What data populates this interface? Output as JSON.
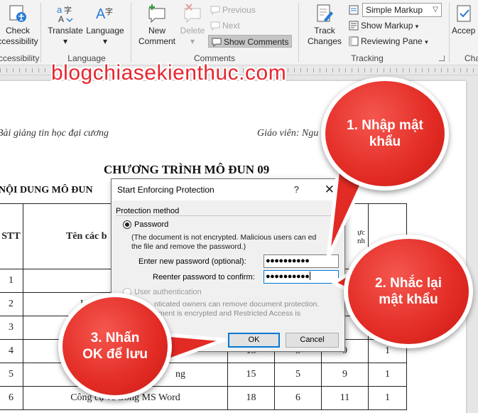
{
  "ribbon": {
    "accessibility": {
      "label_line1": "Check",
      "label_line2": "ccessibility",
      "group": "ccessibility"
    },
    "language_group": {
      "translate_label": "Translate",
      "translate_dropdown": "▾",
      "language_label": "Language",
      "language_dropdown": "▾",
      "group": "Language"
    },
    "comments_group": {
      "new_comment_line1": "New",
      "new_comment_line2": "Comment",
      "delete_label": "Delete",
      "previous_label": "Previous",
      "next_label": "Next",
      "show_comments_label": "Show Comments",
      "group": "Comments"
    },
    "tracking_group": {
      "track_changes_line1": "Track",
      "track_changes_line2": "Changes",
      "markup_dropdown": "Simple Markup",
      "show_markup_label": "Show Markup",
      "reviewing_pane_label": "Reviewing Pane",
      "group": "Tracking"
    },
    "accept_group": {
      "accept_label": "Accep",
      "group": "Cha"
    }
  },
  "watermark": "blogchiasekienthuc.com",
  "document": {
    "header_left": "Bài giảng tin học đại cương",
    "header_right": "Giáo viên: Ngu",
    "heading": "CHƯƠNG TRÌNH MÔ ĐUN 09",
    "subheading": "NỘI DUNG MÔ ĐUN",
    "table": {
      "header": {
        "stt": "STT",
        "name": "Tên các b",
        "col5": "ực",
        "col5b": "nh"
      },
      "rows": [
        {
          "stt": "1",
          "name": "B",
          "c3": "",
          "c4": "",
          "c5": "",
          "c6": ""
        },
        {
          "stt": "2",
          "name": "Làn",
          "c3": "",
          "c4": "",
          "c5": "6",
          "c6": ""
        },
        {
          "stt": "3",
          "name": "",
          "c3": "",
          "c4": "",
          "c5": "7",
          "c6": ""
        },
        {
          "stt": "4",
          "name": "Ch                   rs Word",
          "c3": "15",
          "c4": "5",
          "c5": "9",
          "c6": "1"
        },
        {
          "stt": "5",
          "name": "ng",
          "c3": "15",
          "c4": "5",
          "c5": "9",
          "c6": "1"
        },
        {
          "stt": "6",
          "name": "Công cụ vẽ trong MS Word",
          "c3": "18",
          "c4": "6",
          "c5": "11",
          "c6": "1"
        }
      ]
    }
  },
  "dialog": {
    "title": "Start Enforcing Protection",
    "help": "?",
    "close": "✕",
    "section_label": "Protection method",
    "password_option": "Password",
    "password_note_line1": "(The document is not encrypted. Malicious users can ed",
    "password_note_line2": "the file and remove the password.)",
    "new_password_label": "Enter new password (optional):",
    "new_password_value": "●●●●●●●●●●",
    "reenter_password_label": "Reenter password to confirm:",
    "reenter_password_value": "●●●●●●●●●●",
    "user_auth_option": "User authentication",
    "user_auth_note_line1": "nticated owners can remove document protection.",
    "user_auth_note_line2": "ument is encrypted and Restricted Access is",
    "ok_label": "OK",
    "cancel_label": "Cancel"
  },
  "callouts": [
    {
      "line1": "1. Nhập mật",
      "line2": "khẩu"
    },
    {
      "line1": "2. Nhắc lại",
      "line2": "mật khẩu"
    },
    {
      "line1": "3. Nhấn",
      "line2": "OK để lưu"
    }
  ],
  "colors": {
    "callout_red": "#e22b24",
    "watermark_red": "#e8262e",
    "focus_blue": "#0078d7"
  }
}
